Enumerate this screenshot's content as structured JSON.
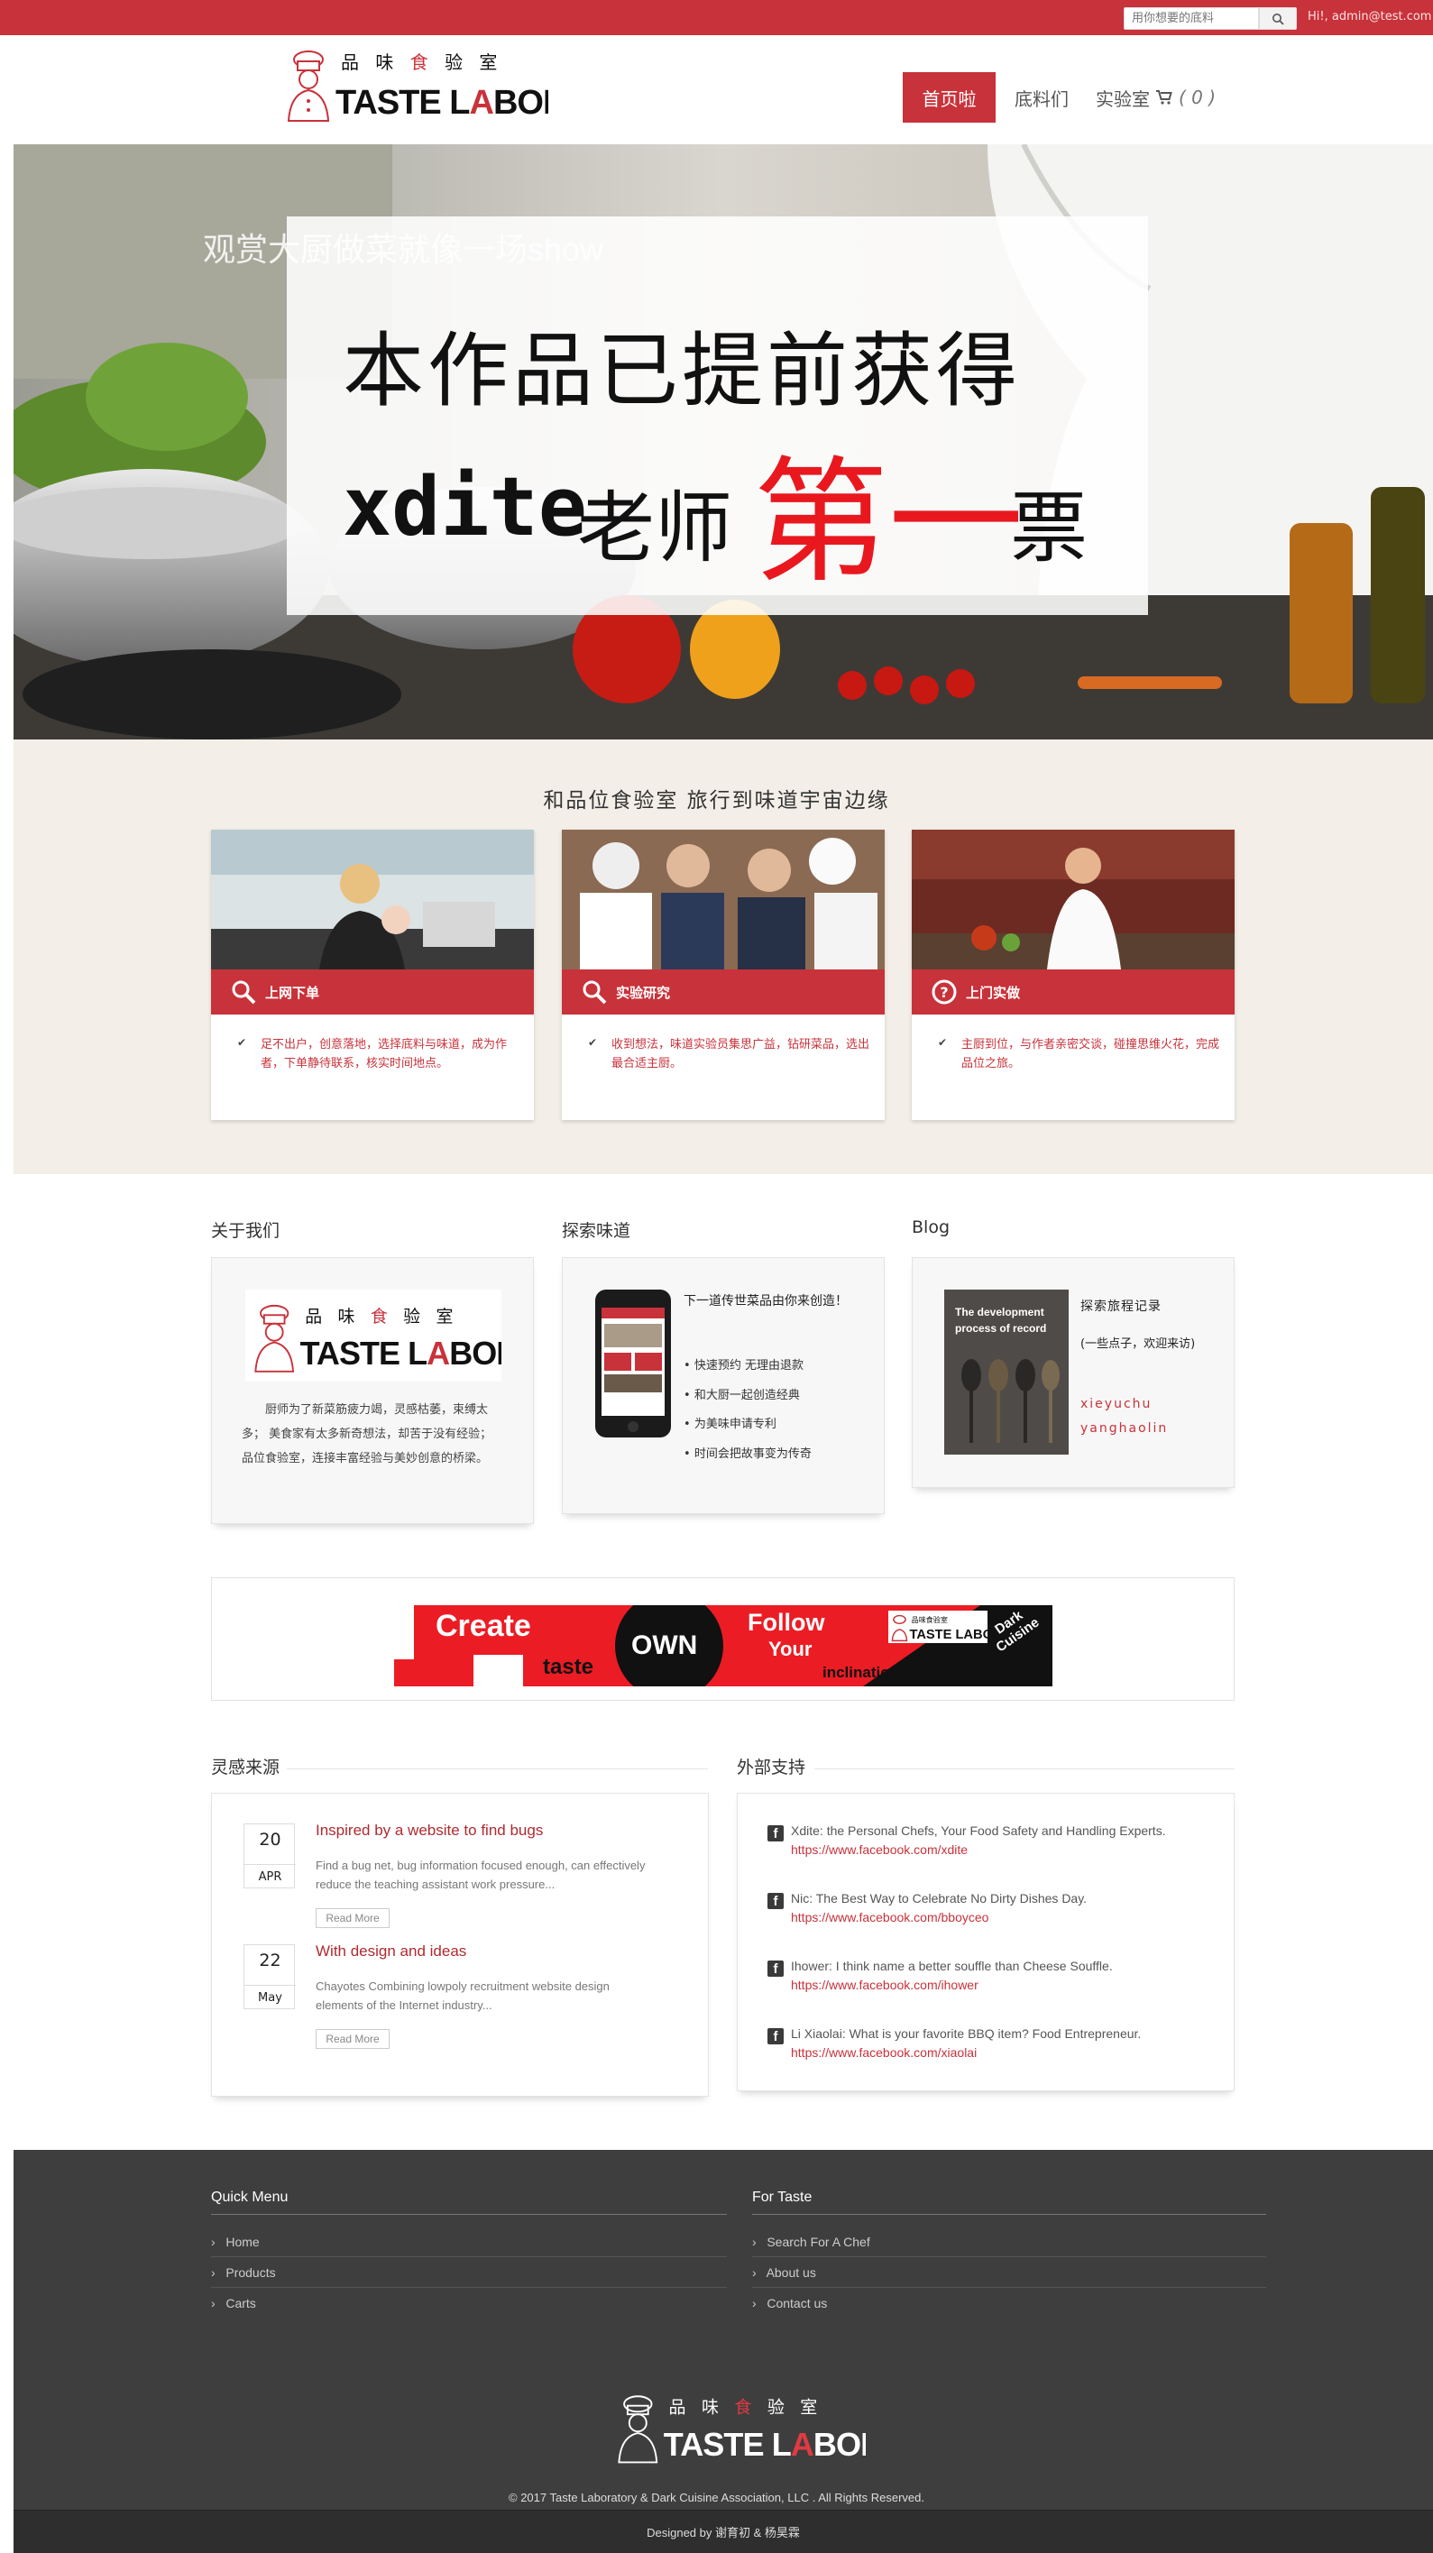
{
  "topbar": {
    "search_placeholder": "用你想要的底料",
    "user_link": "Hi!, admin@test.com"
  },
  "brand": {
    "logo_cn": "品 味 食 验 室",
    "logo_en": "TASTE LABORATORY"
  },
  "nav": {
    "home": "首页啦",
    "products": "底料们",
    "lab": "实验室",
    "cart_count": "( 0 )"
  },
  "hero": {
    "caption": "观赏大厨做菜就像一场show",
    "line1": "本作品已提前获得",
    "line2_a": "xdite",
    "line2_b": "老师",
    "line2_c": "第一",
    "line2_d": "票"
  },
  "features": {
    "title": "和品位食验室 旅行到味道宇宙边缘",
    "cards": [
      {
        "label": "上网下单",
        "text": "足不出户，创意落地，选择底料与味道，成为作者，下单静待联系，核实时间地点。"
      },
      {
        "label": "实验研究",
        "text": "收到想法，味道实验员集思广益，钻研菜品，选出最合适主厨。"
      },
      {
        "label": "上门实做",
        "text": "主厨到位，与作者亲密交谈，碰撞思维火花，完成品位之旅。"
      }
    ]
  },
  "about": {
    "title": "关于我们",
    "text": "厨师为了新菜筋疲力竭，灵感枯萎，束缚太多； 美食家有太多新奇想法，却苦于没有经验； 品位食验室，连接丰富经验与美妙创意的桥梁。"
  },
  "explore": {
    "title": "探索味道",
    "heading": "下一道传世菜品由你来创造！",
    "items": [
      "快速预约 无理由退款",
      "和大厨一起创造经典",
      "为美味申请专利",
      "时间会把故事变为传奇"
    ]
  },
  "blog": {
    "title": "Blog",
    "image_text": "The development process of record",
    "post_title": "探索旅程记录",
    "post_sub": "(一些点子，欢迎来访)",
    "authors": [
      "xieyuchu",
      "yanghaolin"
    ]
  },
  "banner": {
    "w1": "Create",
    "w2": "taste",
    "w3": "OWN",
    "w4": "Follow",
    "w5": "Your",
    "w6": "inclinations",
    "w7": "Dark Cuisine"
  },
  "inspiration": {
    "title": "灵感来源",
    "posts": [
      {
        "day": "20",
        "month": "APR",
        "title": "Inspired by a website to find bugs",
        "body": "Find a bug net, bug information focused enough, can effectively reduce the teaching assistant work pressure...",
        "read_more": "Read More"
      },
      {
        "day": "22",
        "month": "May",
        "title": "With design and ideas",
        "body": "Chayotes Combining lowpoly recruitment website design elements of the Internet industry...",
        "read_more": "Read More"
      }
    ]
  },
  "external": {
    "title": "外部支持",
    "items": [
      {
        "text": "Xdite: the Personal Chefs, Your Food Safety and Handling Experts.",
        "url": "https://www.facebook.com/xdite"
      },
      {
        "text": "Nic: The Best Way to Celebrate No Dirty Dishes Day.",
        "url": "https://www.facebook.com/bboyceo"
      },
      {
        "text": "Ihower: I think name a better souffle than Cheese Souffle.",
        "url": "https://www.facebook.com/ihower"
      },
      {
        "text": "Li Xiaolai: What is your favorite BBQ item? Food Entrepreneur.",
        "url": "https://www.facebook.com/xiaolai"
      }
    ]
  },
  "footer": {
    "quick_title": "Quick Menu",
    "quick_links": [
      "Home",
      "Products",
      "Carts"
    ],
    "taste_title": "For Taste",
    "taste_links": [
      "Search For A Chef",
      "About us",
      "Contact us"
    ],
    "copyright": "© 2017 Taste Laboratory & Dark Cuisine Association, LLC . All Rights Reserved.",
    "designed": "Designed by 谢育初 & 杨昊霖"
  },
  "colors": {
    "brand_red": "#c8323a",
    "footer_bg": "#3e3e3e"
  }
}
